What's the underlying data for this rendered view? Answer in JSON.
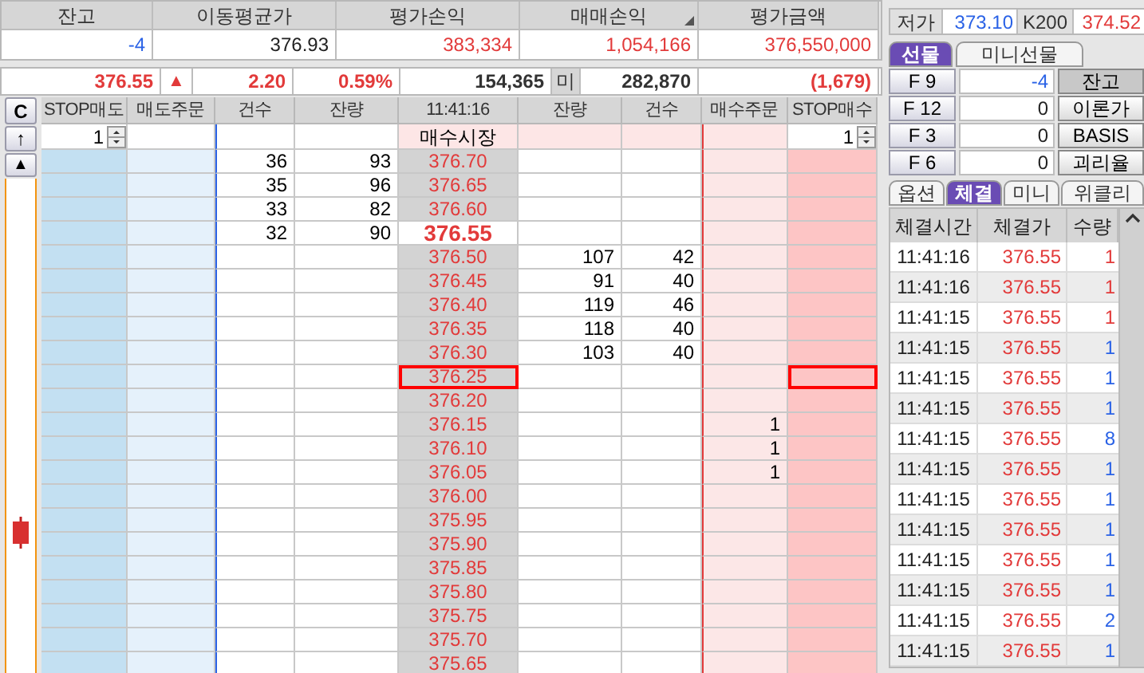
{
  "summary": {
    "columns": [
      "잔고",
      "이동평균가",
      "평가손익",
      "매매손익",
      "평가금액"
    ],
    "values": [
      {
        "text": "-4",
        "color": "#2a62e6"
      },
      {
        "text": "376.93",
        "color": "#222222"
      },
      {
        "text": "383,334",
        "color": "#e23a3a"
      },
      {
        "text": "1,054,166",
        "color": "#e23a3a"
      },
      {
        "text": "376,550,000",
        "color": "#e23a3a"
      }
    ]
  },
  "price_bar": {
    "last": "376.55",
    "arrow": "▲",
    "change": "2.20",
    "rate": "0.59%",
    "volume": "154,365",
    "oi_label": "미",
    "open_interest": "282,870",
    "oi_change": "(1,679)"
  },
  "order_book": {
    "clear_button": "C",
    "up_button": "↑",
    "top_button": "▲",
    "columns": [
      "STOP매도",
      "매도주문",
      "건수",
      "잔량",
      "11:41:16",
      "잔량",
      "건수",
      "매수주문",
      "STOP매수"
    ],
    "stop_sell_qty": "1",
    "market_buy": "매수시장",
    "stop_buy_qty": "1",
    "rows": [
      {
        "price": "376.70",
        "ask_count": "36",
        "ask_qty": "93",
        "current": false,
        "marked": false
      },
      {
        "price": "376.65",
        "ask_count": "35",
        "ask_qty": "96",
        "current": false,
        "marked": false
      },
      {
        "price": "376.60",
        "ask_count": "33",
        "ask_qty": "82",
        "current": false,
        "marked": false
      },
      {
        "price": "376.55",
        "ask_count": "32",
        "ask_qty": "90",
        "current": true,
        "marked": false
      },
      {
        "price": "376.50",
        "bid_qty": "107",
        "bid_count": "42",
        "current": false,
        "marked": false
      },
      {
        "price": "376.45",
        "bid_qty": "91",
        "bid_count": "40",
        "current": false,
        "marked": false
      },
      {
        "price": "376.40",
        "bid_qty": "119",
        "bid_count": "46",
        "current": false,
        "marked": false
      },
      {
        "price": "376.35",
        "bid_qty": "118",
        "bid_count": "40",
        "current": false,
        "marked": false
      },
      {
        "price": "376.30",
        "bid_qty": "103",
        "bid_count": "40",
        "current": false,
        "marked": false
      },
      {
        "price": "376.25",
        "current": false,
        "marked": true
      },
      {
        "price": "376.20",
        "current": false,
        "marked": false
      },
      {
        "price": "376.15",
        "buy_order": "1",
        "current": false,
        "marked": false
      },
      {
        "price": "376.10",
        "buy_order": "1",
        "current": false,
        "marked": false
      },
      {
        "price": "376.05",
        "buy_order": "1",
        "current": false,
        "marked": false
      },
      {
        "price": "376.00",
        "current": false,
        "marked": false
      },
      {
        "price": "375.95",
        "current": false,
        "marked": false
      },
      {
        "price": "375.90",
        "current": false,
        "marked": false
      },
      {
        "price": "375.85",
        "current": false,
        "marked": false
      },
      {
        "price": "375.80",
        "current": false,
        "marked": false
      },
      {
        "price": "375.75",
        "current": false,
        "marked": false
      },
      {
        "price": "375.70",
        "current": false,
        "marked": false
      },
      {
        "price": "375.65",
        "current": false,
        "marked": false
      }
    ]
  },
  "quote": [
    {
      "label": "저가",
      "value": "373.10",
      "color": "#2a62e6"
    },
    {
      "label": "K200",
      "value": "374.52",
      "color": "#e23a3a"
    }
  ],
  "market_tabs": [
    {
      "label": "선물",
      "selected": true
    },
    {
      "label": "미니선물",
      "selected": false
    }
  ],
  "futures": [
    {
      "key": "F 9",
      "value": "-4",
      "color": "#2a62e6",
      "action": "잔고",
      "pressed": true
    },
    {
      "key": "F 12",
      "value": "0",
      "color": "#222222",
      "action": "이론가",
      "pressed": false
    },
    {
      "key": "F 3",
      "value": "0",
      "color": "#222222",
      "action": "BASIS",
      "pressed": false
    },
    {
      "key": "F 6",
      "value": "0",
      "color": "#222222",
      "action": "괴리율",
      "pressed": false
    }
  ],
  "trade_tabs": [
    {
      "label": "옵션",
      "selected": false
    },
    {
      "label": "체결",
      "selected": true
    },
    {
      "label": "미니",
      "selected": false
    },
    {
      "label": "위클리",
      "selected": false
    }
  ],
  "trades": {
    "columns": [
      "체결시간",
      "체결가",
      "수량"
    ],
    "rows": [
      {
        "time": "11:41:16",
        "price": "376.55",
        "qty": "1",
        "color": "#e23a3a"
      },
      {
        "time": "11:41:16",
        "price": "376.55",
        "qty": "1",
        "color": "#e23a3a"
      },
      {
        "time": "11:41:15",
        "price": "376.55",
        "qty": "1",
        "color": "#e23a3a"
      },
      {
        "time": "11:41:15",
        "price": "376.55",
        "qty": "1",
        "color": "#2a62e6"
      },
      {
        "time": "11:41:15",
        "price": "376.55",
        "qty": "1",
        "color": "#2a62e6"
      },
      {
        "time": "11:41:15",
        "price": "376.55",
        "qty": "1",
        "color": "#2a62e6"
      },
      {
        "time": "11:41:15",
        "price": "376.55",
        "qty": "8",
        "color": "#2a62e6"
      },
      {
        "time": "11:41:15",
        "price": "376.55",
        "qty": "1",
        "color": "#2a62e6"
      },
      {
        "time": "11:41:15",
        "price": "376.55",
        "qty": "1",
        "color": "#2a62e6"
      },
      {
        "time": "11:41:15",
        "price": "376.55",
        "qty": "1",
        "color": "#2a62e6"
      },
      {
        "time": "11:41:15",
        "price": "376.55",
        "qty": "1",
        "color": "#2a62e6"
      },
      {
        "time": "11:41:15",
        "price": "376.55",
        "qty": "1",
        "color": "#2a62e6"
      },
      {
        "time": "11:41:15",
        "price": "376.55",
        "qty": "2",
        "color": "#2a62e6"
      },
      {
        "time": "11:41:15",
        "price": "376.55",
        "qty": "1",
        "color": "#2a62e6"
      }
    ]
  }
}
